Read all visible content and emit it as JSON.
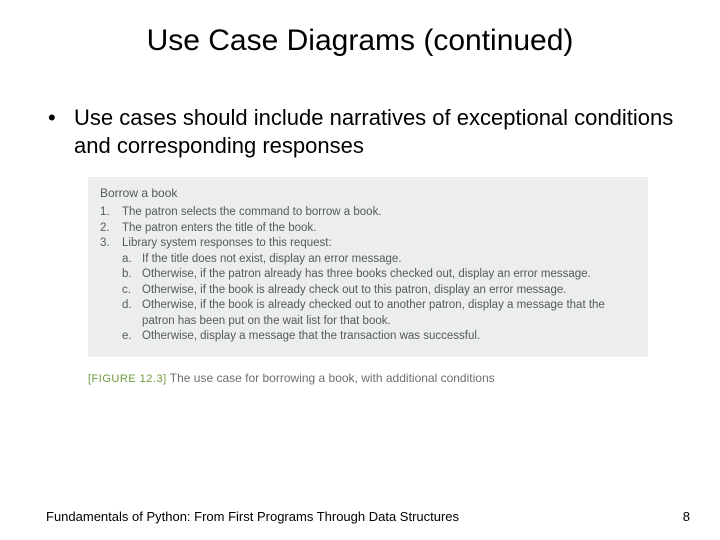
{
  "title": "Use Case Diagrams (continued)",
  "bullet": {
    "dot": "•",
    "text": "Use cases should include narratives of exceptional conditions and corresponding responses"
  },
  "figure": {
    "heading": "Borrow a book",
    "steps": [
      {
        "n": "1.",
        "t": "The patron selects the command to borrow a book."
      },
      {
        "n": "2.",
        "t": "The patron enters the title of the book."
      },
      {
        "n": "3.",
        "t": "Library system responses to this request:"
      }
    ],
    "subs": [
      {
        "l": "a.",
        "t": "If the title does not exist, display an error message."
      },
      {
        "l": "b.",
        "t": "Otherwise, if the patron already has three books checked out, display an error message."
      },
      {
        "l": "c.",
        "t": "Otherwise, if the book is already check out to this patron, display an error message."
      },
      {
        "l": "d.",
        "t": "Otherwise, if the book is already checked out to another patron, display a message that the patron has been put on the wait list for that book."
      },
      {
        "l": "e.",
        "t": "Otherwise, display a message that the transaction was successful."
      }
    ],
    "caption_label": "[FIGURE 12.3]",
    "caption_text": "The use case for borrowing a book, with additional conditions"
  },
  "footer": {
    "left": "Fundamentals of Python: From First Programs Through Data Structures",
    "right": "8"
  }
}
